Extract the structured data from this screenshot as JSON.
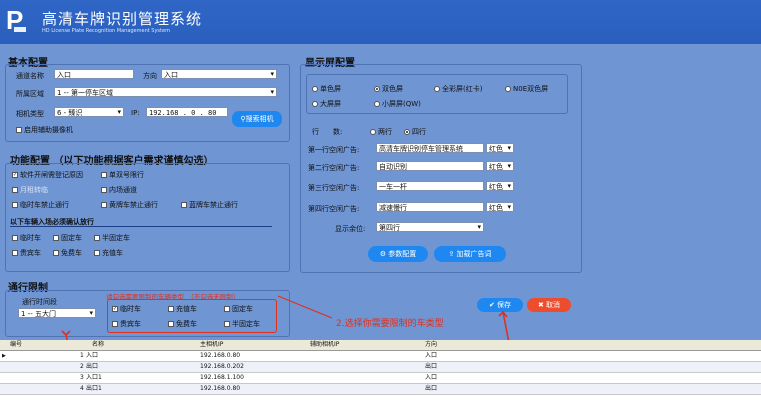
{
  "app": {
    "title": "高清车牌识别管理系统",
    "subtitle": "HD License Plate Recognition Management System",
    "logo_letter": "P"
  },
  "basic": {
    "title": "基本配置",
    "channel_name_label": "通道名称",
    "channel_name_value": "入口",
    "direction_label": "方向",
    "direction_value": "入口",
    "area_label": "所属区域",
    "area_value": "1 -- 第一停车区域",
    "camera_type_label": "相机类型",
    "camera_type_value": "6 - 臻识",
    "ip_label": "IP:",
    "ip_value": "192.168 . 0 . 80",
    "search_camera_label": "搜索相机",
    "aux_camera_label": "启用辅助摄像机"
  },
  "display": {
    "title": "显示屏配置",
    "screen_types": [
      {
        "label": "单色屏",
        "on": false
      },
      {
        "label": "双色屏",
        "on": true
      },
      {
        "label": "全彩屏(红卡)",
        "on": false
      },
      {
        "label": "N0E双色屏",
        "on": false
      },
      {
        "label": "大屏屏",
        "on": false
      },
      {
        "label": "小屏屏(QW)",
        "on": false
      }
    ],
    "rows_label": "行　　数:",
    "rows_opt1": "两行",
    "rows_opt2": "四行",
    "ad_rows": [
      {
        "label": "第一行空闲广告:",
        "value": "高清车牌识别停车管理系统",
        "color": "红色"
      },
      {
        "label": "第二行空闲广告:",
        "value": "自动识别",
        "color": "红色"
      },
      {
        "label": "第三行空闲广告:",
        "value": "一车一杆",
        "color": "红色"
      },
      {
        "label": "第四行空闲广告:",
        "value": "减速慢行",
        "color": "红色"
      }
    ],
    "unit_label": "显示余位:",
    "unit_value": "第四行",
    "param_btn": "参数配置",
    "load_btn": "加载广告词"
  },
  "func": {
    "title": "功能配置 （以下功能根据客户需求谨慎勾选）",
    "items1": [
      {
        "label": "软件开闸需登记原因",
        "on": true
      },
      {
        "label": "单双号限行",
        "on": false
      },
      {
        "label": "月租转临",
        "on": false
      },
      {
        "label": "内场通道",
        "on": false
      },
      {
        "label": "临时车禁止通行",
        "on": false
      },
      {
        "label": "黄牌车禁止通行",
        "on": false
      },
      {
        "label": "蓝牌车禁止通行",
        "on": false
      }
    ],
    "subtitle": "以下车辆入场必须确认放行",
    "items2": [
      {
        "label": "临时车",
        "on": false
      },
      {
        "label": "固定车",
        "on": false
      },
      {
        "label": "半固定车",
        "on": false
      },
      {
        "label": "贵宾车",
        "on": false
      },
      {
        "label": "免费车",
        "on": false
      },
      {
        "label": "充值车",
        "on": false
      }
    ]
  },
  "restrict": {
    "title": "通行限制",
    "period_label": "通行时间段",
    "period_value": "1 -- 五大门",
    "hint": "请勾选需要限制的车辆类型　（不勾选无限制）",
    "types": [
      {
        "label": "临时车",
        "on": true
      },
      {
        "label": "充值车",
        "on": false
      },
      {
        "label": "固定车",
        "on": false
      },
      {
        "label": "贵宾车",
        "on": false
      },
      {
        "label": "免费车",
        "on": false
      },
      {
        "label": "半固定车",
        "on": false
      }
    ],
    "annotation": "2.选择你需要限制的车类型",
    "save_btn": "保存",
    "cancel_btn": "取消"
  },
  "table": {
    "headers": [
      "编号",
      "名称",
      "主相机IP",
      "辅助相机IP",
      "方向"
    ],
    "rows": [
      {
        "no": "1",
        "name": "入口",
        "ip": "192.168.0.80",
        "aux": "",
        "dir": "入口"
      },
      {
        "no": "2",
        "name": "出口",
        "ip": "192.168.0.202",
        "aux": "",
        "dir": "出口"
      },
      {
        "no": "3",
        "name": "入口1",
        "ip": "192.168.1.100",
        "aux": "",
        "dir": "入口"
      },
      {
        "no": "4",
        "name": "出口1",
        "ip": "192.168.0.80",
        "aux": "",
        "dir": "出口"
      }
    ]
  },
  "colors": {
    "header": "#2f66c6",
    "background": "#6f95d3",
    "accent_blue": "#1e88f0",
    "accent_red": "#ee4d2d",
    "annotation_red": "#e0301e"
  }
}
